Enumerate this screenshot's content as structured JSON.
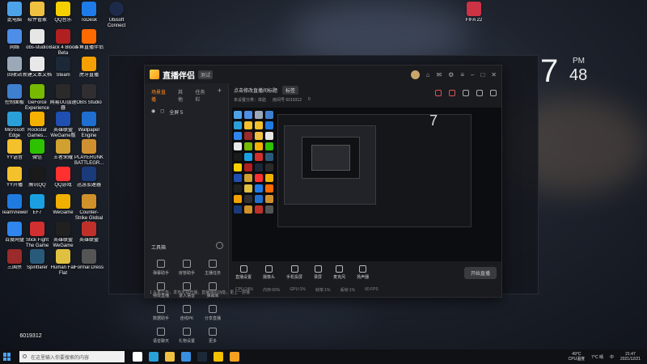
{
  "desktop": {
    "icons_col1": [
      {
        "label": "此电脑",
        "color": "#4da3e8"
      },
      {
        "label": "网络",
        "color": "#4d8ee8"
      },
      {
        "label": "回收站",
        "color": "#9aa8b8"
      },
      {
        "label": "控制面板",
        "color": "#3f7fd0"
      },
      {
        "label": "Microsoft Edge",
        "color": "#2aa0d8"
      },
      {
        "label": "YY语音",
        "color": "#f3c12b"
      },
      {
        "label": "YY开播",
        "color": "#f3c12b"
      },
      {
        "label": "TeamViewer",
        "color": "#1f7be0"
      },
      {
        "label": "百度网盘",
        "color": "#2f86ee"
      },
      {
        "label": "三国杀",
        "color": "#9b2a2a"
      }
    ],
    "icons_col2": [
      {
        "label": "软件管家",
        "color": "#f0c040"
      },
      {
        "label": "obs-studio",
        "color": "#e6e6e6"
      },
      {
        "label": "新建文本文档",
        "color": "#e8e8e8"
      },
      {
        "label": "GeForce Experience",
        "color": "#76b900"
      },
      {
        "label": "Rockstar Games...",
        "color": "#f5b000"
      },
      {
        "label": "微信",
        "color": "#2dc100"
      },
      {
        "label": "腾讯QQ",
        "color": "#1a1a1a"
      },
      {
        "label": "EF7",
        "color": "#1aa0e0"
      },
      {
        "label": "Stick Fight The Game",
        "color": "#d03030"
      },
      {
        "label": "Spiritfarer",
        "color": "#2a5a7a"
      }
    ],
    "icons_col3": [
      {
        "label": "QQ音乐",
        "color": "#f5d000"
      },
      {
        "label": "Back 4 Blood Beta",
        "color": "#b02020"
      },
      {
        "label": "Steam",
        "color": "#1b2838"
      },
      {
        "label": "网易UU加速器",
        "color": "#2a2a2a"
      },
      {
        "label": "英雄联盟WeGame版",
        "color": "#1f4fb0"
      },
      {
        "label": "王者荣耀",
        "color": "#d0a030"
      },
      {
        "label": "QQ游戏",
        "color": "#ff3030"
      },
      {
        "label": "WeGame",
        "color": "#f0b000"
      },
      {
        "label": "英雄联盟WeGame",
        "color": "#202020"
      },
      {
        "label": "Human Fall Flat",
        "color": "#e0c040"
      }
    ],
    "icons_col4": [
      {
        "label": "ToDesk",
        "color": "#1e7ce8"
      },
      {
        "label": "斗鱼直播伴侣",
        "color": "#ff6a00"
      },
      {
        "label": "虎牙直播",
        "color": "#f5a000"
      },
      {
        "label": "OBS Studio",
        "color": "#302e31"
      },
      {
        "label": "Wallpaper Engine",
        "color": "#1f6fd0"
      },
      {
        "label": "PLAYERUNKNOWN'S BATTLEGR...",
        "color": "#d09030"
      },
      {
        "label": "迅游加速器",
        "color": "#1a3a7a"
      },
      {
        "label": "Counter-Strike Global Of...",
        "color": "#d0902a"
      },
      {
        "label": "英雄联盟",
        "color": "#c0302a"
      },
      {
        "label": "Formal Dress",
        "color": "#555"
      }
    ],
    "ubisoft_label": "Ubisoft Connect",
    "fifa_label": "FIFA 22",
    "clock_hour": "7",
    "clock_pm": "PM",
    "clock_min": "48",
    "streamer_id": "6019312"
  },
  "app": {
    "title": "直播伴侣",
    "version": "测试",
    "tabs": [
      "场景直播",
      "其他",
      "任务栏"
    ],
    "scene": "全屏 5",
    "room_title": "点击修改直播间标题",
    "room_tag": "标签",
    "room_category": "未设置分类：体验",
    "room_id_label": "房间号",
    "room_id": "6019312",
    "likes": "0",
    "toolbox_title": "工具箱",
    "tools": [
      "弹幕助手",
      "房管助手",
      "主播任务",
      "特效直播",
      "录入语音",
      "弹幕库",
      "数据助手",
      "连线PK",
      "分享直播",
      "语音聊天",
      "礼物设置",
      "更多"
    ],
    "bottom_buttons": [
      "直播设置",
      "摄像头",
      "手机投屏",
      "录屏",
      "麦克风",
      "扬声器"
    ],
    "start_label": "开始直播",
    "notice": "1 头条公告，发布无损开播，直播伴侣功能，更上一层楼",
    "status": [
      "CPU:24%",
      "内存:60%",
      "GPU:1%",
      "帧率:1%",
      "丢帧:1%",
      "60 FPS"
    ]
  },
  "taskbar": {
    "search_placeholder": "在这里输入你要搜索的内容",
    "apps": [
      {
        "name": "task-view-icon",
        "color": "#ffffff"
      },
      {
        "name": "edge-icon",
        "color": "#2aa0d8"
      },
      {
        "name": "explorer-icon",
        "color": "#f0c040"
      },
      {
        "name": "store-icon",
        "color": "#3a8ee0"
      },
      {
        "name": "steam-icon",
        "color": "#1b2838"
      },
      {
        "name": "yellow-app-icon",
        "color": "#f5c000"
      },
      {
        "name": "stream-app-icon",
        "color": "#f5a020"
      }
    ],
    "temp_value": "49°C",
    "temp_label": "CPU温度",
    "weather": "7°C 晴",
    "lang": "中",
    "time": "21:47",
    "date": "2021/12/21"
  }
}
